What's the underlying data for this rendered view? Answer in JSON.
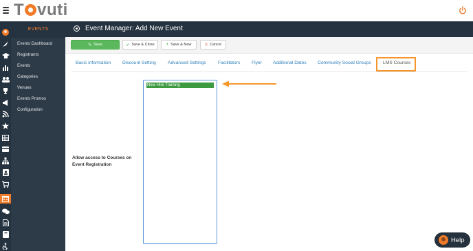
{
  "brand": {
    "name": "Tovuti",
    "name_before_o": "T",
    "name_after_o": "vuti",
    "accent_color": "#f07c2a"
  },
  "sidebar": {
    "heading": "EVENTS",
    "items": [
      {
        "label": "Events Dashboard"
      },
      {
        "label": "Registrants"
      },
      {
        "label": "Events"
      },
      {
        "label": "Categories"
      },
      {
        "label": "Venues"
      },
      {
        "label": "Events Promos"
      },
      {
        "label": "Configuration"
      }
    ]
  },
  "rail_icons": [
    "avatar-icon",
    "rocket-icon",
    "graduation-cap-icon",
    "bar-chart-icon",
    "users-icon",
    "trophy-icon",
    "megaphone-icon",
    "feed-icon",
    "star-icon",
    "table-icon",
    "credit-card-icon",
    "org-chart-icon",
    "contact-card-icon",
    "cart-icon",
    "calendar-icon",
    "comments-icon",
    "document-icon",
    "book-icon",
    "accessibility-icon"
  ],
  "header": {
    "title": "Event Manager: Add New Event"
  },
  "toolbar": {
    "save_label": "Save",
    "save_close_label": "Save & Close",
    "save_new_label": "Save & New",
    "cancel_label": "Cancel"
  },
  "tabs": [
    {
      "label": "Basic information"
    },
    {
      "label": "Discount Setting"
    },
    {
      "label": "Advanced Settings"
    },
    {
      "label": "Facilitators"
    },
    {
      "label": "Flyer"
    },
    {
      "label": "Additional Dates"
    },
    {
      "label": "Community Social Groups"
    },
    {
      "label": "LMS Courses",
      "active": true
    }
  ],
  "lms": {
    "field_label": "Allow access to Courses on Event Registration",
    "options": [
      {
        "label": "New Hire Training",
        "selected": true
      }
    ]
  },
  "help": {
    "label": "Help"
  },
  "colors": {
    "highlight": "#f5962b",
    "save_green": "#5cb85c",
    "nav_dark": "#253341",
    "link_blue": "#2d7fb8"
  }
}
